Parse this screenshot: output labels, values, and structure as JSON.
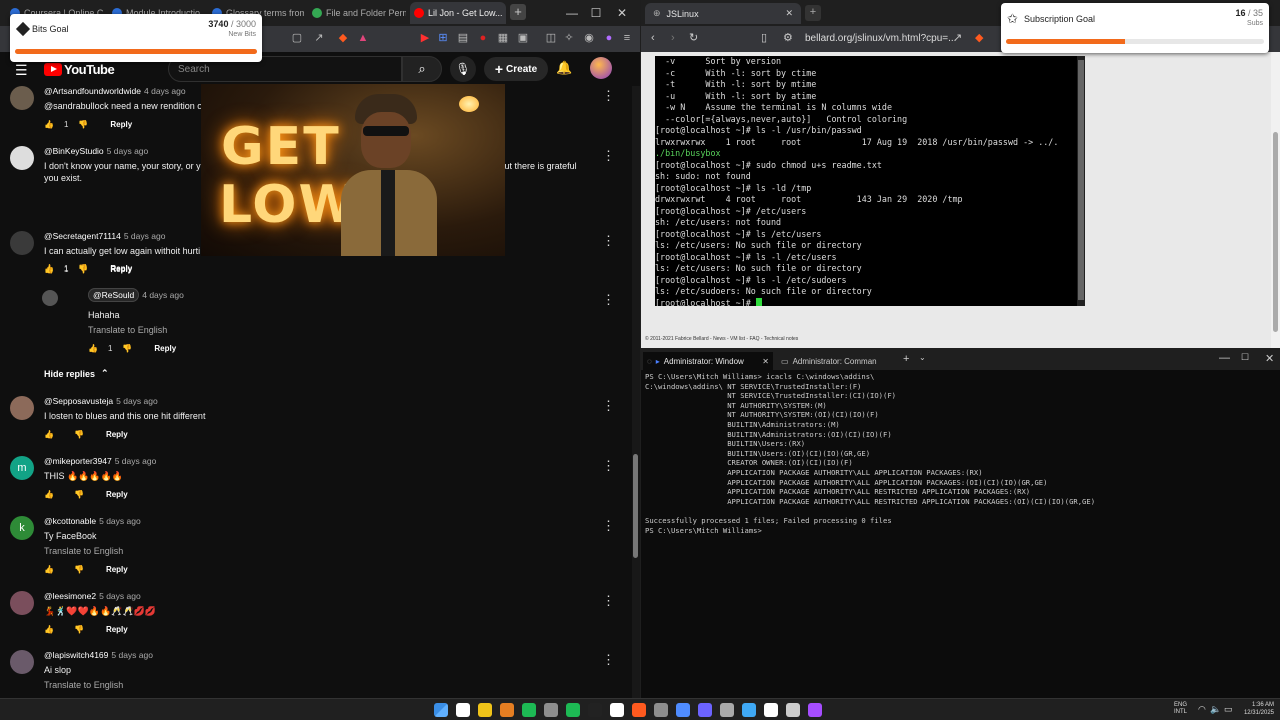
{
  "left_browser": {
    "tabs": [
      {
        "label": "Coursera | Online C...",
        "color": "#2b6cd4"
      },
      {
        "label": "Module Introductio...",
        "color": "#2b6cd4"
      },
      {
        "label": "Glossary terms from...",
        "color": "#2b6cd4"
      },
      {
        "label": "File and Folder Perm...",
        "color": "#34a853"
      },
      {
        "label": "Lil Jon - Get Low...",
        "color": "#ff0000"
      }
    ],
    "window_buttons": [
      "—",
      "☐",
      "✕"
    ]
  },
  "youtube": {
    "logo": "YouTube",
    "search_placeholder": "Search",
    "create_label": "Create"
  },
  "video_overlay": {
    "line1": "GET",
    "line2": "LOW"
  },
  "comments": [
    {
      "author": "@Artsandfoundworldwide",
      "ago": "4 days ago",
      "text": "@sandrabullock need a new rendition of",
      "likes": "1",
      "reply": "Reply",
      "avatar_color": "#6b5d4d",
      "initial": ""
    },
    {
      "author": "@BinKeyStudio",
      "ago": "5 days ago",
      "text": "I don't know your name, your story, or yo... ...ling, of happiness, and of peace. So please don't give up. K... ...eone out there is grateful you exist.",
      "likes": "1",
      "reply": "Reply",
      "avatar_color": "#dddddd",
      "initial": ""
    },
    {
      "author": "@Secretagent71114",
      "ago": "5 days ago",
      "text": "I can actually get low again withoit hurti",
      "likes": "1",
      "reply": "Reply",
      "avatar_color": "#3a3a3a",
      "initial": ""
    },
    {
      "author": "@ReSould",
      "ago": "4 days ago",
      "text": "Hahaha",
      "translate": "Translate to English",
      "likes": "1",
      "reply": "Reply",
      "avatar_color": "#555555",
      "initial": ""
    },
    {
      "author": "@Sepposavusteja",
      "ago": "5 days ago",
      "text": "I losten to blues and this one hit different",
      "likes": "",
      "reply": "Reply",
      "avatar_color": "#8c6a5a",
      "initial": ""
    },
    {
      "author": "@mikeporter3947",
      "ago": "5 days ago",
      "text": "THIS 🔥🔥🔥🔥🔥",
      "likes": "",
      "reply": "Reply",
      "avatar_color": "#12a386",
      "initial": "m"
    },
    {
      "author": "@kcottonable",
      "ago": "5 days ago",
      "text": "Ty FaceBook",
      "translate": "Translate to English",
      "likes": "",
      "reply": "Reply",
      "avatar_color": "#2e8b37",
      "initial": "k"
    },
    {
      "author": "@leesimone2",
      "ago": "5 days ago",
      "text": "💃🕺❤️❤️🔥🔥🥂🥂💋💋",
      "likes": "",
      "reply": "Reply",
      "avatar_color": "#7a4e5c",
      "initial": ""
    },
    {
      "author": "@lapiswitch4169",
      "ago": "5 days ago",
      "text": "Ai slop",
      "translate": "Translate to English",
      "likes": "",
      "reply": "",
      "avatar_color": "#6a5a6a",
      "initial": ""
    }
  ],
  "hide_replies": "Hide replies",
  "bits_goal": {
    "label": "Bits Goal",
    "current": "3740",
    "target": "/ 3000",
    "sub": "New Bits",
    "progress": 1.0
  },
  "sub_goal": {
    "label": "Subscription Goal",
    "current": "16",
    "target": "/ 35",
    "sub": "Subs",
    "progress": 0.46
  },
  "right_browser": {
    "tab_label": "JSLinux",
    "url": "bellard.org/jslinux/vm.html?cpu=...",
    "footer": "© 2011-2021 Fabrice Bellard - News - VM list - FAQ - Technical notes"
  },
  "terminal_lines": [
    "  -v      Sort by version",
    "  -c      With -l: sort by ctime",
    "  -t      With -l: sort by mtime",
    "  -u      With -l: sort by atime",
    "  -w N    Assume the terminal is N columns wide",
    "  --color[={always,never,auto}]   Control coloring",
    "[root@localhost ~]# ls -l /usr/bin/passwd",
    "lrwxrwxrwx    1 root     root            17 Aug 19  2018 /usr/bin/passwd -> ../.",
    "./bin/busybox",
    "[root@localhost ~]# sudo chmod u+s readme.txt",
    "sh: sudo: not found",
    "[root@localhost ~]# ls -ld /tmp",
    "drwxrwxrwt    4 root     root           143 Jan 29  2020 /tmp",
    "[root@localhost ~]# /etc/users",
    "sh: /etc/users: not found",
    "[root@localhost ~]# ls /etc/users",
    "ls: /etc/users: No such file or directory",
    "[root@localhost ~]# ls -l /etc/users",
    "ls: /etc/users: No such file or directory",
    "[root@localhost ~]# ls -l /etc/sudoers",
    "ls: /etc/sudoers: No such file or directory",
    "[root@localhost ~]# "
  ],
  "powershell": {
    "tab1": "Administrator: Window",
    "tab2": "Administrator: Comman",
    "lines": [
      "PS C:\\Users\\Mitch Williams> icacls C:\\windows\\addins\\",
      "C:\\windows\\addins\\ NT SERVICE\\TrustedInstaller:(F)",
      "                   NT SERVICE\\TrustedInstaller:(CI)(IO)(F)",
      "                   NT AUTHORITY\\SYSTEM:(M)",
      "                   NT AUTHORITY\\SYSTEM:(OI)(CI)(IO)(F)",
      "                   BUILTIN\\Administrators:(M)",
      "                   BUILTIN\\Administrators:(OI)(CI)(IO)(F)",
      "                   BUILTIN\\Users:(RX)",
      "                   BUILTIN\\Users:(OI)(CI)(IO)(GR,GE)",
      "                   CREATOR OWNER:(OI)(CI)(IO)(F)",
      "                   APPLICATION PACKAGE AUTHORITY\\ALL APPLICATION PACKAGES:(RX)",
      "                   APPLICATION PACKAGE AUTHORITY\\ALL APPLICATION PACKAGES:(OI)(CI)(IO)(GR,GE)",
      "                   APPLICATION PACKAGE AUTHORITY\\ALL RESTRICTED APPLICATION PACKAGES:(RX)",
      "                   APPLICATION PACKAGE AUTHORITY\\ALL RESTRICTED APPLICATION PACKAGES:(OI)(CI)(IO)(GR,GE)",
      "",
      "Successfully processed 1 files; Failed processing 0 files",
      "PS C:\\Users\\Mitch Williams> "
    ]
  },
  "taskbar": {
    "lang_top": "ENG",
    "lang_bottom": "INTL",
    "time": "1:36 AM",
    "date": "12/31/2025",
    "icons": [
      "#3a8ee6",
      "#ffffff",
      "#f0c419",
      "#e67e22",
      "#1db954",
      "#8e8e8e",
      "#1db954",
      "#222222",
      "#ffffff",
      "#ff5a1f",
      "#8e8e8e",
      "#4f8cff",
      "#6c63ff",
      "#aaaaaa",
      "#3fa9f5",
      "#ffffff",
      "#cccccc",
      "#a64dff"
    ]
  }
}
